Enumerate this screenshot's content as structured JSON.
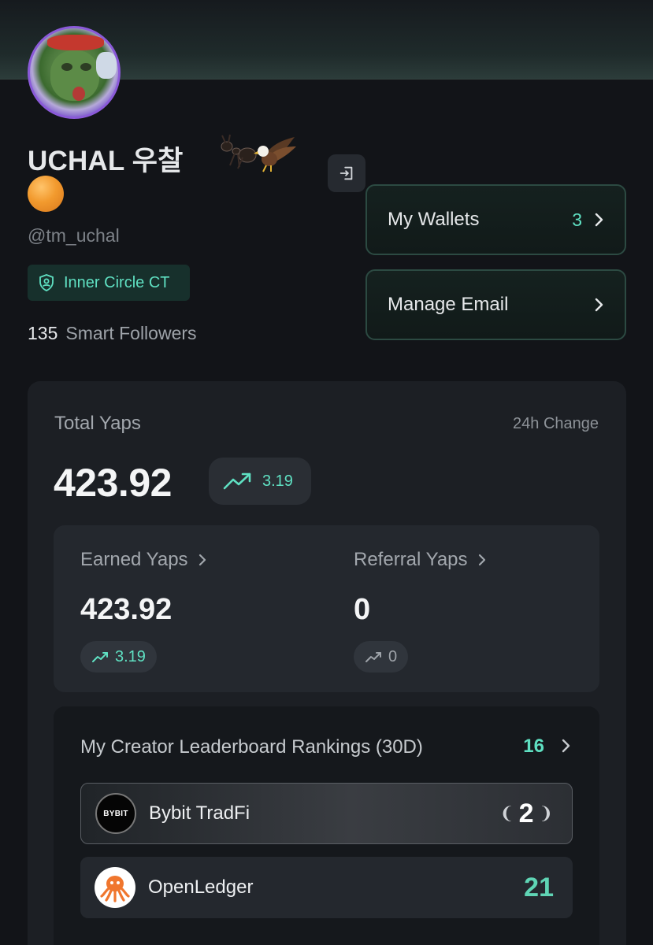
{
  "profile": {
    "name": "UCHAL 우찰",
    "handle": "@tm_uchal",
    "badge": "Inner Circle CT",
    "smart_followers_count": "135",
    "smart_followers_label": "Smart Followers"
  },
  "actions": {
    "wallets_label": "My Wallets",
    "wallets_count": "3",
    "email_label": "Manage Email"
  },
  "yaps": {
    "total_label": "Total Yaps",
    "change_label": "24h Change",
    "total_value": "423.92",
    "total_change": "3.19",
    "earned_label": "Earned Yaps",
    "earned_value": "423.92",
    "earned_change": "3.19",
    "referral_label": "Referral Yaps",
    "referral_value": "0",
    "referral_change": "0"
  },
  "rankings": {
    "title": "My Creator Leaderboard Rankings (30D)",
    "count": "16",
    "rows": [
      {
        "name": "Bybit TradFi",
        "logo_text": "BYBIT",
        "rank": "2"
      },
      {
        "name": "OpenLedger",
        "rank": "21"
      }
    ]
  },
  "colors": {
    "accent": "#5fe0c2",
    "background": "#121418",
    "card": "#1c1f24",
    "avatar_ring": "#8a5ad8"
  }
}
